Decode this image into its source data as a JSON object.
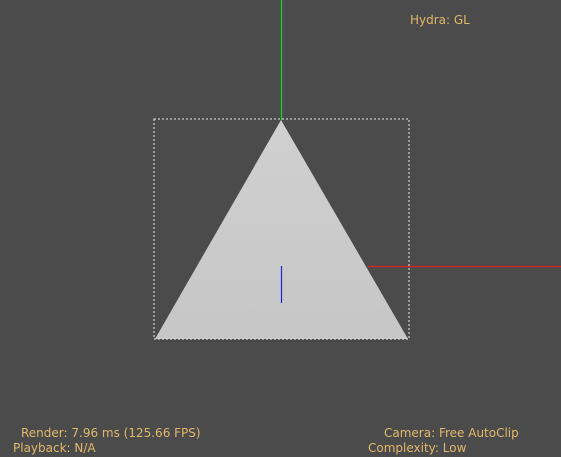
{
  "hud": {
    "renderer": "Hydra: GL",
    "render_stats": "Render: 7.96 ms (125.66 FPS)",
    "playback": "Playback: N/A",
    "camera": "Camera: Free AutoClip",
    "complexity": "Complexity: Low"
  },
  "colors": {
    "background": "#4b4b4b",
    "hud_text": "#e2b86b",
    "mesh_fill": "#cccccc",
    "bbox": "#eeeeee",
    "axis_x": "#e02020",
    "axis_y": "#20d020",
    "axis_z": "#2020e0"
  },
  "icons": {
    "mesh": "triangle-mesh",
    "bounding_box": "dashed-bounding-box",
    "axes": "xyz-axis-gizmo"
  }
}
